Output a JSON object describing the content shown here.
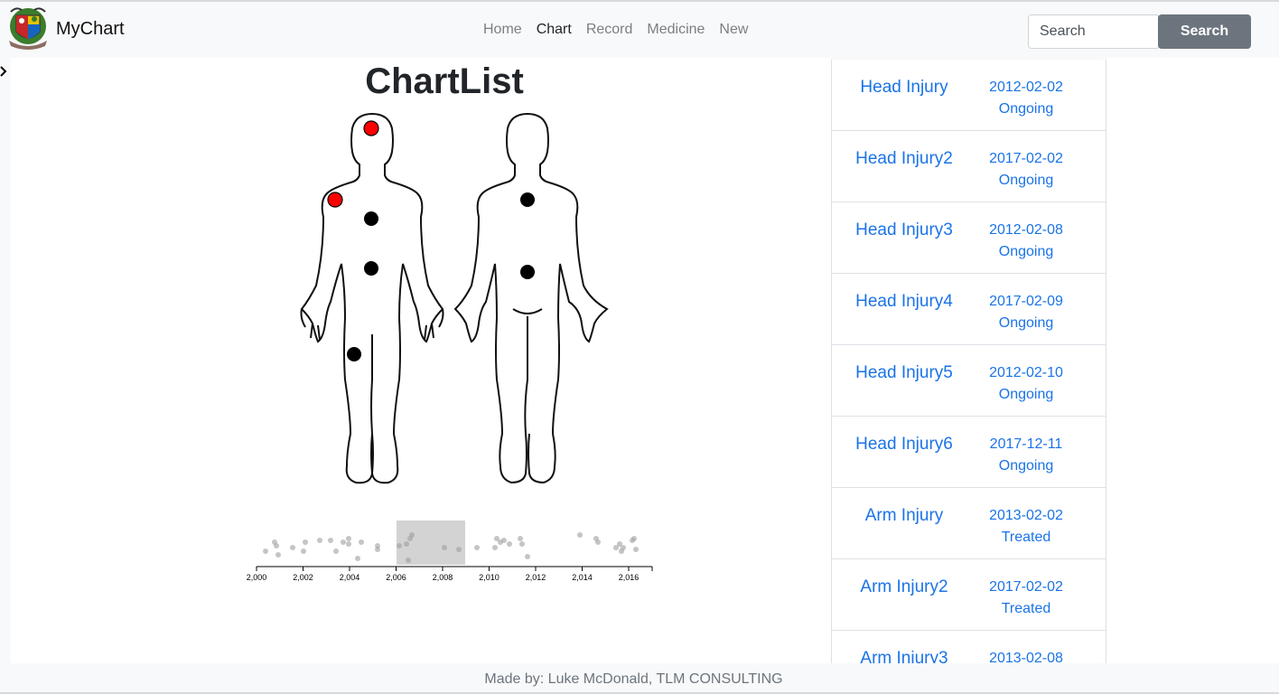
{
  "navbar": {
    "brand": "MyChart",
    "links": [
      {
        "label": "Home",
        "active": false
      },
      {
        "label": "Chart",
        "active": true
      },
      {
        "label": "Record",
        "active": false
      },
      {
        "label": "Medicine",
        "active": false
      },
      {
        "label": "New",
        "active": false
      }
    ],
    "search_placeholder": "Search",
    "search_button": "Search"
  },
  "main": {
    "title": "ChartList",
    "back_icon": "chevron-right-icon",
    "body_markers": [
      {
        "view": "front",
        "location": "head",
        "color": "#ff0000"
      },
      {
        "view": "front",
        "location": "right-shoulder",
        "color": "#ff0000"
      },
      {
        "view": "front",
        "location": "chest",
        "color": "#000000"
      },
      {
        "view": "front",
        "location": "abdomen",
        "color": "#000000"
      },
      {
        "view": "front",
        "location": "right-thigh",
        "color": "#000000"
      },
      {
        "view": "back",
        "location": "upper-back",
        "color": "#000000"
      },
      {
        "view": "back",
        "location": "lower-back",
        "color": "#000000"
      }
    ],
    "timeline": {
      "ticks": [
        "2,000",
        "2,002",
        "2,004",
        "2,006",
        "2,008",
        "2,010",
        "2,012",
        "2,014",
        "2,016"
      ],
      "brush_range": [
        2006,
        2008.9
      ]
    }
  },
  "list": {
    "items": [
      {
        "name": "Head Injury",
        "date": "2012-02-02",
        "status": "Ongoing"
      },
      {
        "name": "Head Injury2",
        "date": "2017-02-02",
        "status": "Ongoing"
      },
      {
        "name": "Head Injury3",
        "date": "2012-02-08",
        "status": "Ongoing"
      },
      {
        "name": "Head Injury4",
        "date": "2017-02-09",
        "status": "Ongoing"
      },
      {
        "name": "Head Injury5",
        "date": "2012-02-10",
        "status": "Ongoing"
      },
      {
        "name": "Head Injury6",
        "date": "2017-12-11",
        "status": "Ongoing"
      },
      {
        "name": "Arm Injury",
        "date": "2013-02-02",
        "status": "Treated"
      },
      {
        "name": "Arm Injury2",
        "date": "2017-02-02",
        "status": "Treated"
      },
      {
        "name": "Arm Injury3",
        "date": "2013-02-08",
        "status": ""
      }
    ]
  },
  "footer": {
    "text": "Made by: Luke McDonald, TLM CONSULTING"
  },
  "colors": {
    "link": "#1a73e8",
    "button": "#6c757d",
    "marker_active": "#ff0000",
    "marker": "#000000"
  }
}
